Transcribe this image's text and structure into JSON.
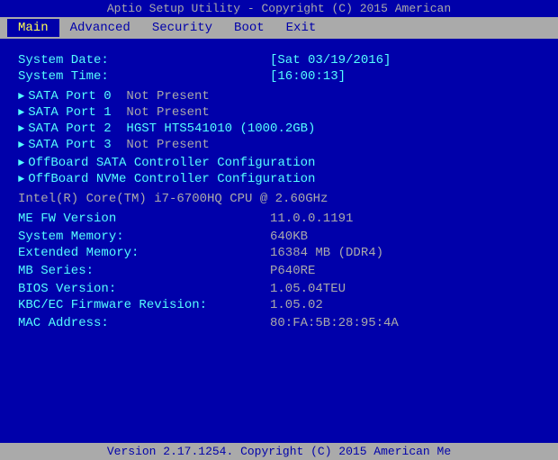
{
  "title_bar": {
    "text": "Aptio Setup Utility - Copyright (C) 2015 American"
  },
  "menu": {
    "items": [
      {
        "label": "Main",
        "active": true
      },
      {
        "label": "Advanced",
        "active": false
      },
      {
        "label": "Security",
        "active": false
      },
      {
        "label": "Boot",
        "active": false
      },
      {
        "label": "Exit",
        "active": false
      }
    ]
  },
  "system_date": {
    "label": "System Date:",
    "value": "[Sat 03/19/2016]"
  },
  "system_time": {
    "label": "System Time:",
    "value": "[16:00:13]"
  },
  "sata_ports": [
    {
      "port": "SATA Port 0",
      "status": "Not Present"
    },
    {
      "port": "SATA Port 1",
      "status": "Not Present"
    },
    {
      "port": "SATA Port 2",
      "status": "HGST HTS541010 (1000.2GB)"
    },
    {
      "port": "SATA Port 3",
      "status": "Not Present"
    }
  ],
  "offboard": [
    {
      "label": "OffBoard SATA Controller Configuration"
    },
    {
      "label": "OffBoard NVMe Controller Configuration"
    }
  ],
  "cpu": {
    "text": "Intel(R) Core(TM) i7-6700HQ CPU @ 2.60GHz"
  },
  "me_fw": {
    "label": "ME FW Version",
    "value": "11.0.0.1191"
  },
  "system_memory": {
    "label": "System Memory:",
    "value": "640KB"
  },
  "extended_memory": {
    "label": "Extended Memory:",
    "value": "16384 MB (DDR4)"
  },
  "mb_series": {
    "label": "MB Series:",
    "value": "P640RE"
  },
  "bios_version": {
    "label": "BIOS Version:",
    "value": "1.05.04TEU"
  },
  "kbc_ec": {
    "label": "KBC/EC Firmware Revision:",
    "value": "1.05.02"
  },
  "mac_address": {
    "label": "MAC Address:",
    "value": "80:FA:5B:28:95:4A"
  },
  "status_bar": {
    "text": "Version 2.17.1254. Copyright (C) 2015 American Me"
  }
}
